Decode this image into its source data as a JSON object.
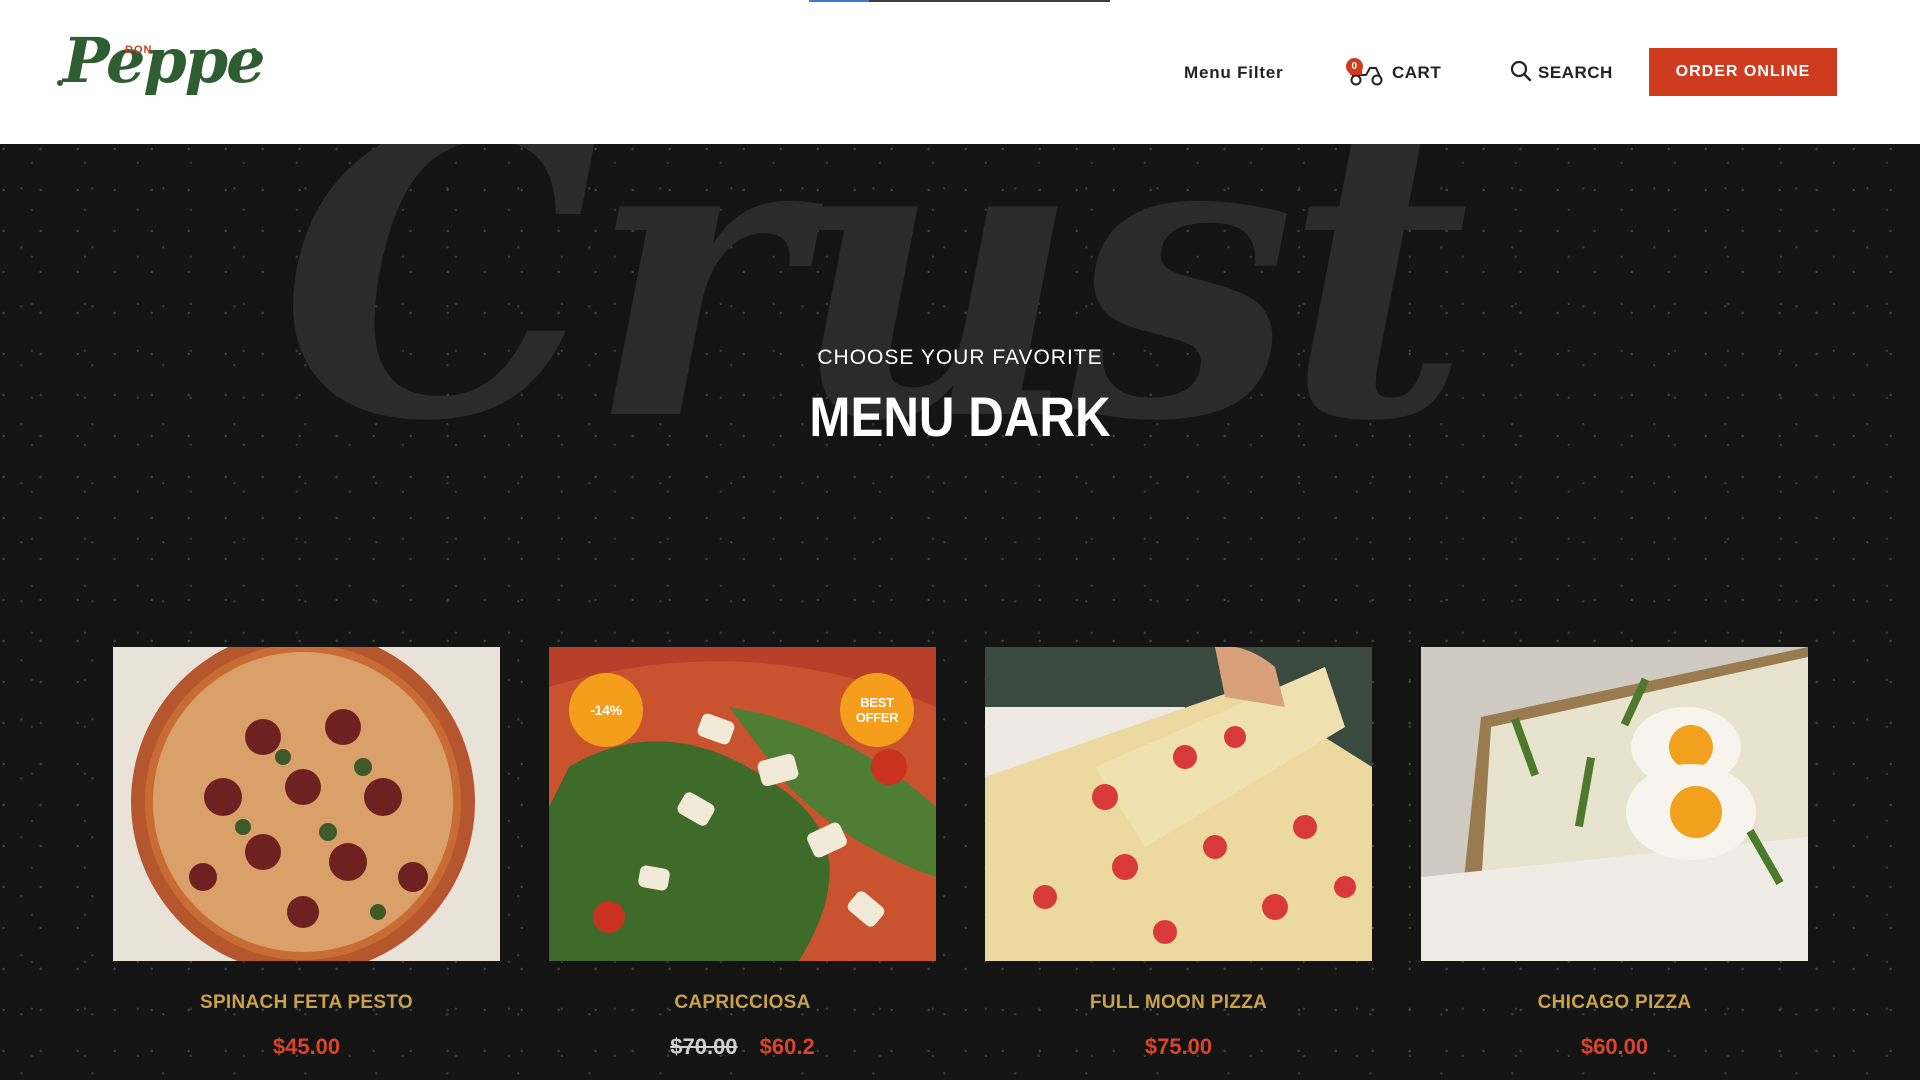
{
  "brand": {
    "prefix": "DON",
    "name": "Peppe"
  },
  "nav": {
    "menu_filter": "Menu Filter",
    "cart_label": "CART",
    "cart_count": "0",
    "search_label": "SEARCH",
    "order_label": "ORDER ONLINE"
  },
  "hero": {
    "watermark": "Crust",
    "subtitle": "CHOOSE YOUR FAVORITE",
    "title": "MENU DARK"
  },
  "products": [
    {
      "name": "SPINACH FETA PESTO",
      "price": "$45.00"
    },
    {
      "name": "CAPRICCIOSA",
      "old_price": "$70.00",
      "price": "$60.2",
      "discount_badge": "-14%",
      "offer_badge": "BEST OFFER"
    },
    {
      "name": "FULL MOON PIZZA",
      "price": "$75.00"
    },
    {
      "name": "CHICAGO PIZZA",
      "price": "$60.00"
    }
  ],
  "colors": {
    "accent": "#cf3b1f",
    "brand_green": "#2f5d32",
    "product_name": "#c9a24a",
    "price": "#d8452a",
    "badge": "#f59e1b",
    "background": "#141414"
  },
  "icons": [
    "cart-scooter-icon",
    "search-icon"
  ]
}
